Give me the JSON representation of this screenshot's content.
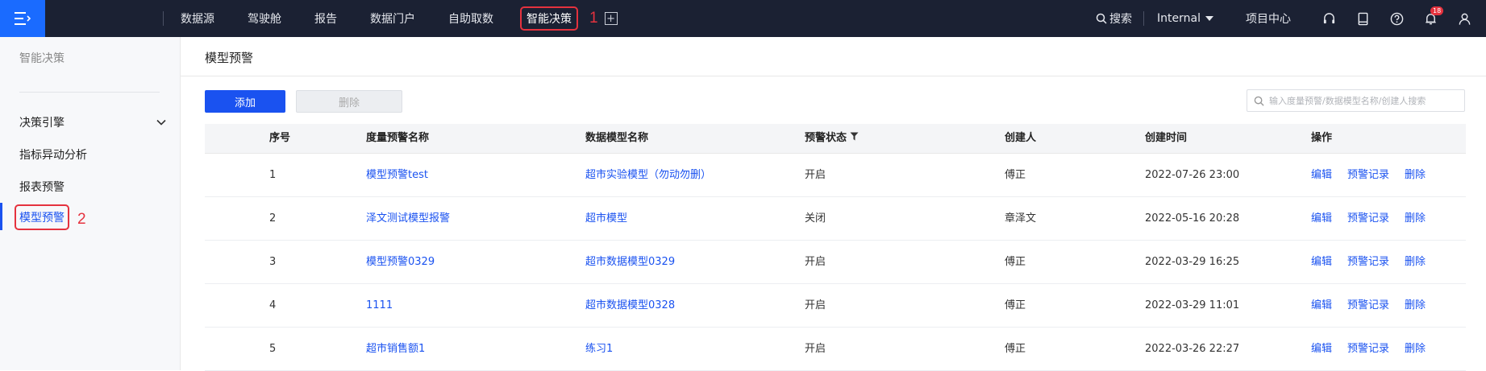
{
  "topbar": {
    "nav": [
      "数据源",
      "驾驶舱",
      "报告",
      "数据门户",
      "自助取数"
    ],
    "active_nav": "智能决策",
    "annotation_1": "1",
    "search_label": "搜索",
    "workspace": "Internal",
    "project_center": "项目中心",
    "notification_count": "18"
  },
  "sidebar": {
    "title": "智能决策",
    "group_label": "决策引擎",
    "items": [
      "指标异动分析",
      "报表预警"
    ],
    "active_item": "模型预警",
    "annotation_2": "2"
  },
  "main": {
    "page_title": "模型预警",
    "add_button": "添加",
    "delete_button": "删除",
    "search_placeholder": "输入度量预警/数据模型名称/创建人搜索",
    "columns": [
      "序号",
      "度量预警名称",
      "数据模型名称",
      "预警状态",
      "创建人",
      "创建时间",
      "操作"
    ],
    "ops": [
      "编辑",
      "预警记录",
      "删除"
    ],
    "rows": [
      {
        "index": "1",
        "alert_name": "模型预警test",
        "model_name": "超市实验模型（勿动勿删）",
        "status": "开启",
        "creator": "傅正",
        "created_at": "2022-07-26 23:00"
      },
      {
        "index": "2",
        "alert_name": "泽文测试模型报警",
        "model_name": "超市模型",
        "status": "关闭",
        "creator": "章泽文",
        "created_at": "2022-05-16 20:28"
      },
      {
        "index": "3",
        "alert_name": "模型预警0329",
        "model_name": "超市数据模型0329",
        "status": "开启",
        "creator": "傅正",
        "created_at": "2022-03-29 16:25"
      },
      {
        "index": "4",
        "alert_name": "1111",
        "model_name": "超市数据模型0328",
        "status": "开启",
        "creator": "傅正",
        "created_at": "2022-03-29 11:01"
      },
      {
        "index": "5",
        "alert_name": "超市销售额1",
        "model_name": "练习1",
        "status": "开启",
        "creator": "傅正",
        "created_at": "2022-03-26 22:27"
      }
    ]
  }
}
